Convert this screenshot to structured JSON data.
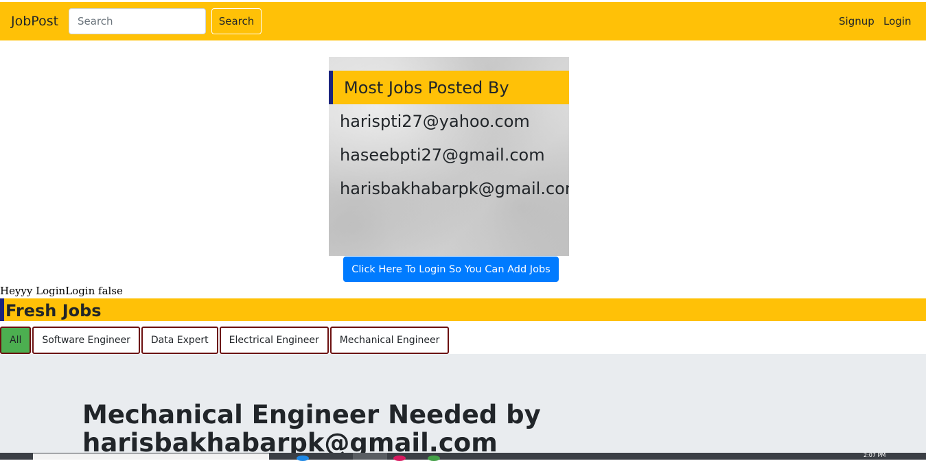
{
  "navbar": {
    "brand": "JobPost",
    "search_placeholder": "Search",
    "search_button": "Search",
    "signup": "Signup",
    "login": "Login"
  },
  "poster_card": {
    "title": "Most Jobs Posted By",
    "emails": [
      "harispti27@yahoo.com",
      "haseebpti27@gmail.com",
      "harisbakhabarpk@gmail.com"
    ]
  },
  "login_cta": "Click Here To Login So You Can Add Jobs",
  "debug_text": "Heyyy LoginLogin false",
  "fresh_jobs": {
    "title": "Fresh Jobs",
    "filters": [
      "All",
      "Software Engineer",
      "Data Expert",
      "Electrical Engineer",
      "Mechanical Engineer"
    ],
    "active_filter": "All"
  },
  "job": {
    "title": "Mechanical Engineer Needed by harisbakhabarpk@gmail.com"
  },
  "taskbar": {
    "clock": "2:07 PM"
  },
  "colors": {
    "navbar": "#ffc107",
    "accent_bar": "#1a237e",
    "cta": "#007bff",
    "active_filter": "#4caf50",
    "filter_border": "#6b0f0f",
    "jobs_background": "#e9ecef"
  }
}
